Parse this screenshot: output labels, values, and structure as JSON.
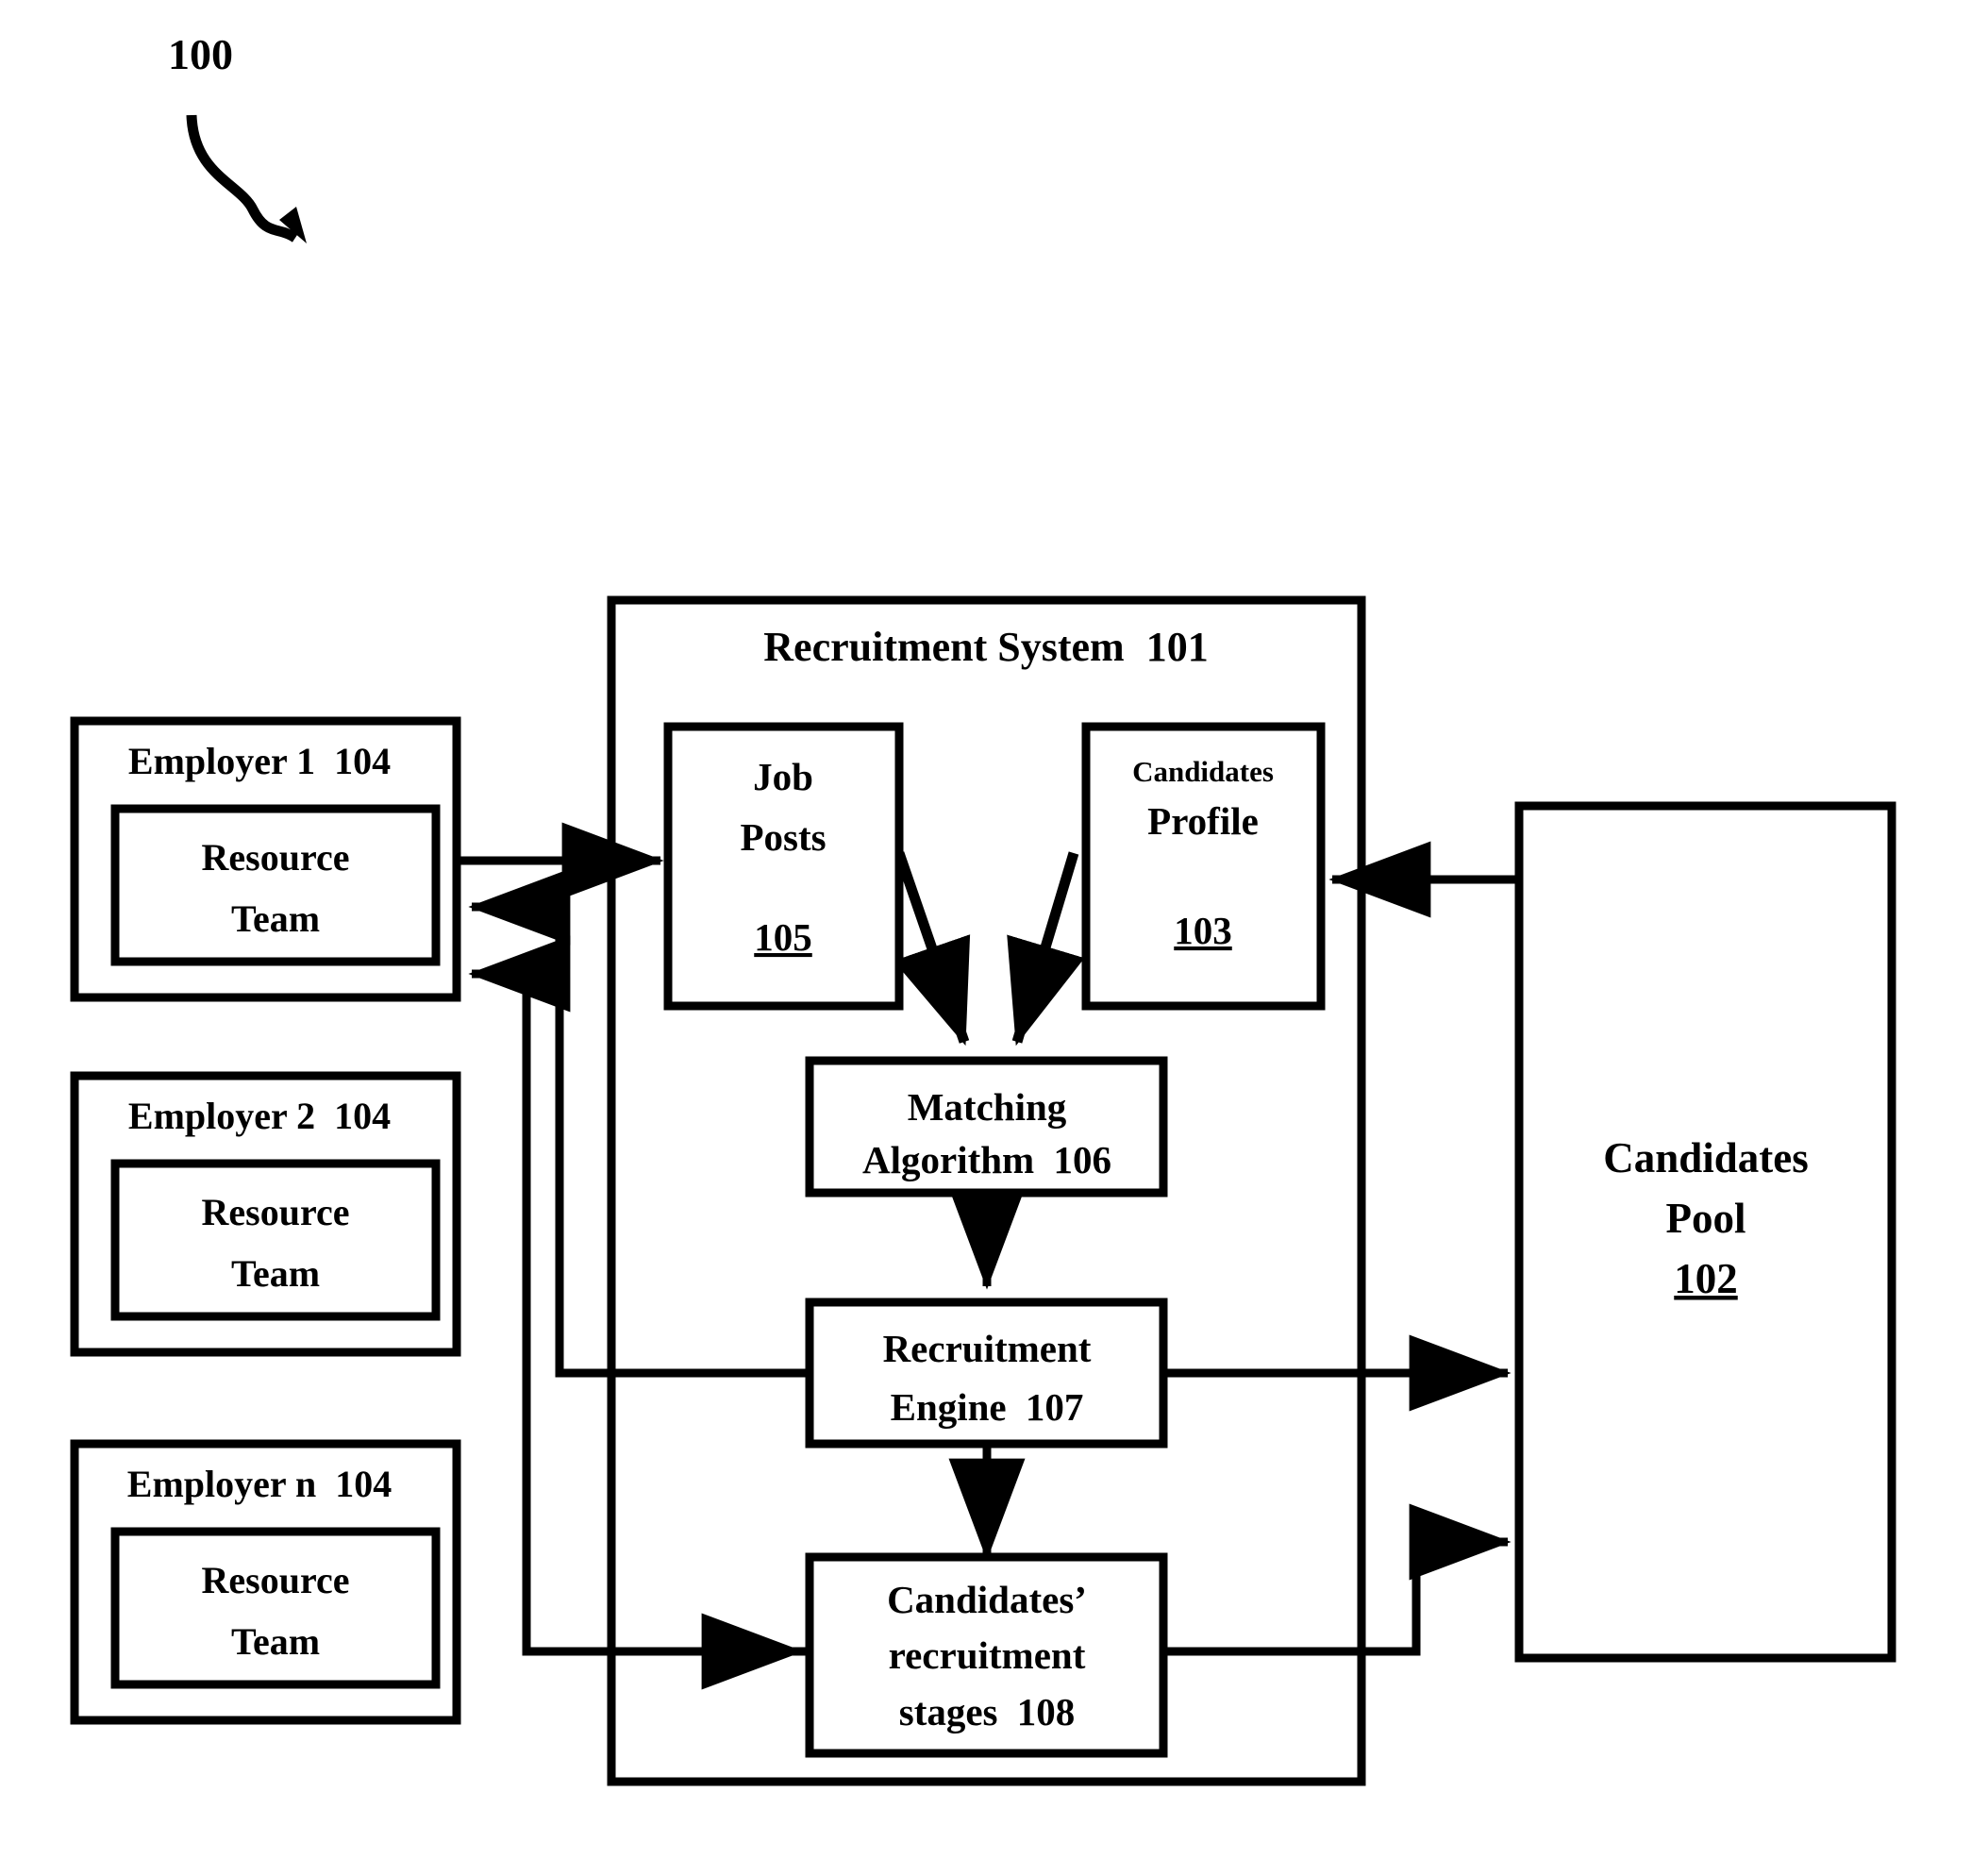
{
  "figure": {
    "number": "100",
    "callout_icon": "curved-arrow-icon"
  },
  "recruitment_system": {
    "title": "Recruitment System",
    "ref": "101"
  },
  "employers": [
    {
      "label": "Employer 1",
      "ref": "104",
      "inner": {
        "line1": "Resource",
        "line2": "Team"
      }
    },
    {
      "label": "Employer 2",
      "ref": "104",
      "inner": {
        "line1": "Resource",
        "line2": "Team"
      }
    },
    {
      "label": "Employer n",
      "ref": "104",
      "inner": {
        "line1": "Resource",
        "line2": "Team"
      }
    }
  ],
  "nodes": {
    "job_posts": {
      "line1": "Job",
      "line2": "Posts",
      "ref": "105"
    },
    "candidates_profile": {
      "line1": "Candidates",
      "line2": "Profile",
      "ref": "103"
    },
    "matching": {
      "line1": "Matching",
      "line2": "Algorithm",
      "ref": "106"
    },
    "engine": {
      "line1": "Recruitment",
      "line2": "Engine",
      "ref": "107"
    },
    "stages": {
      "line1": "Candidates’",
      "line2": "recruitment",
      "line3": "stages",
      "ref": "108"
    },
    "candidates_pool": {
      "line1": "Candidates",
      "line2": "Pool",
      "ref": "102"
    }
  },
  "connections": [
    {
      "name": "employer1-to-job-posts",
      "from": "Employer 1 Resource Team",
      "to": "Job Posts 105",
      "direction": "right"
    },
    {
      "name": "engine-to-employer1",
      "from": "Recruitment Engine 107",
      "to": "Employer 1",
      "direction": "left"
    },
    {
      "name": "stages-to-employer1",
      "from": "Candidates’ recruitment stages 108",
      "to": "Employer 1",
      "direction": "left"
    },
    {
      "name": "job-posts-to-matching",
      "from": "Job Posts 105",
      "to": "Matching Algorithm 106",
      "direction": "diagonal-down-right"
    },
    {
      "name": "candidates-profile-to-matching",
      "from": "Candidates Profile 103",
      "to": "Matching Algorithm 106",
      "direction": "diagonal-down-left"
    },
    {
      "name": "matching-to-engine",
      "from": "Matching Algorithm 106",
      "to": "Recruitment Engine 107",
      "direction": "down"
    },
    {
      "name": "engine-to-stages",
      "from": "Recruitment Engine 107",
      "to": "Candidates’ recruitment stages 108",
      "direction": "down"
    },
    {
      "name": "engine-to-candidates-pool",
      "from": "Recruitment Engine 107",
      "to": "Candidates Pool 102",
      "direction": "right"
    },
    {
      "name": "stages-to-candidates-pool",
      "from": "Candidates’ recruitment stages 108",
      "to": "Candidates Pool 102",
      "direction": "right-up"
    },
    {
      "name": "candidates-pool-to-profile",
      "from": "Candidates Pool 102",
      "to": "Candidates Profile 103",
      "direction": "left"
    },
    {
      "name": "employern-to-stages",
      "from": "Employer n area",
      "to": "Candidates’ recruitment stages 108",
      "direction": "right"
    }
  ],
  "colors": {
    "ink": "#000000",
    "paper": "#ffffff"
  }
}
